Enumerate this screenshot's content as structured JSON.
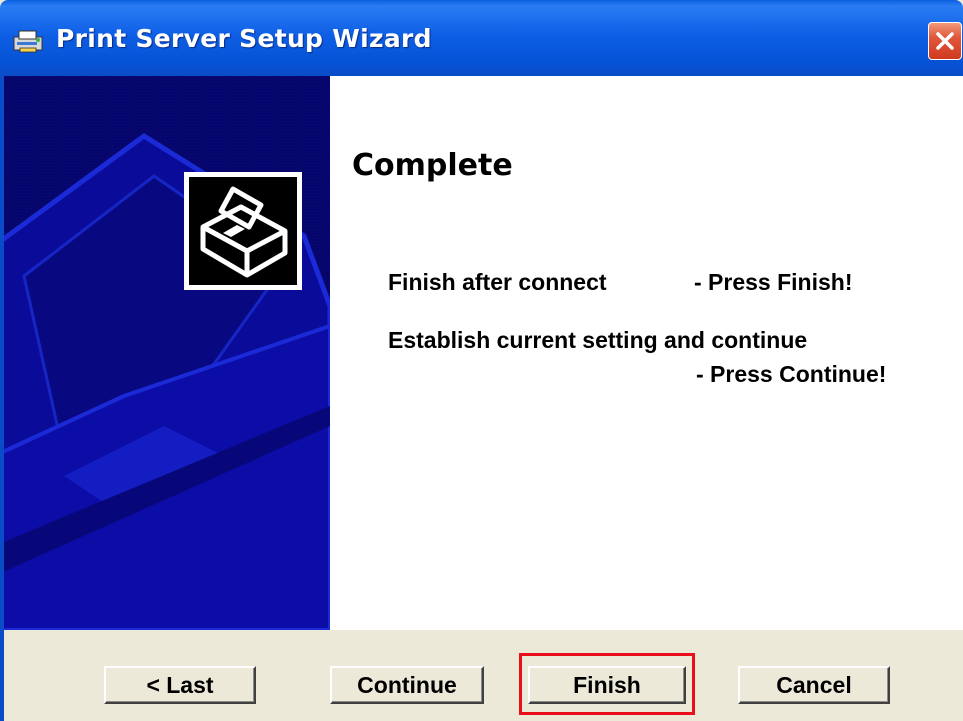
{
  "window": {
    "title": "Print Server Setup Wizard",
    "app_icon": "printer-setup-icon",
    "close_icon": "close-icon",
    "accent": "#0a5fe0",
    "close_color": "#e0573a"
  },
  "side_panel": {
    "background": "#05055f",
    "logo_icon": "printer-icon"
  },
  "content": {
    "heading": "Complete",
    "line1_left": "Finish after connect",
    "line1_right": "- Press Finish!",
    "line2": "Establish current setting and continue",
    "line3": "- Press Continue!"
  },
  "buttons": {
    "last": "< Last",
    "continue": "Continue",
    "finish": "Finish",
    "cancel": "Cancel",
    "highlight_color": "#e8111b"
  }
}
